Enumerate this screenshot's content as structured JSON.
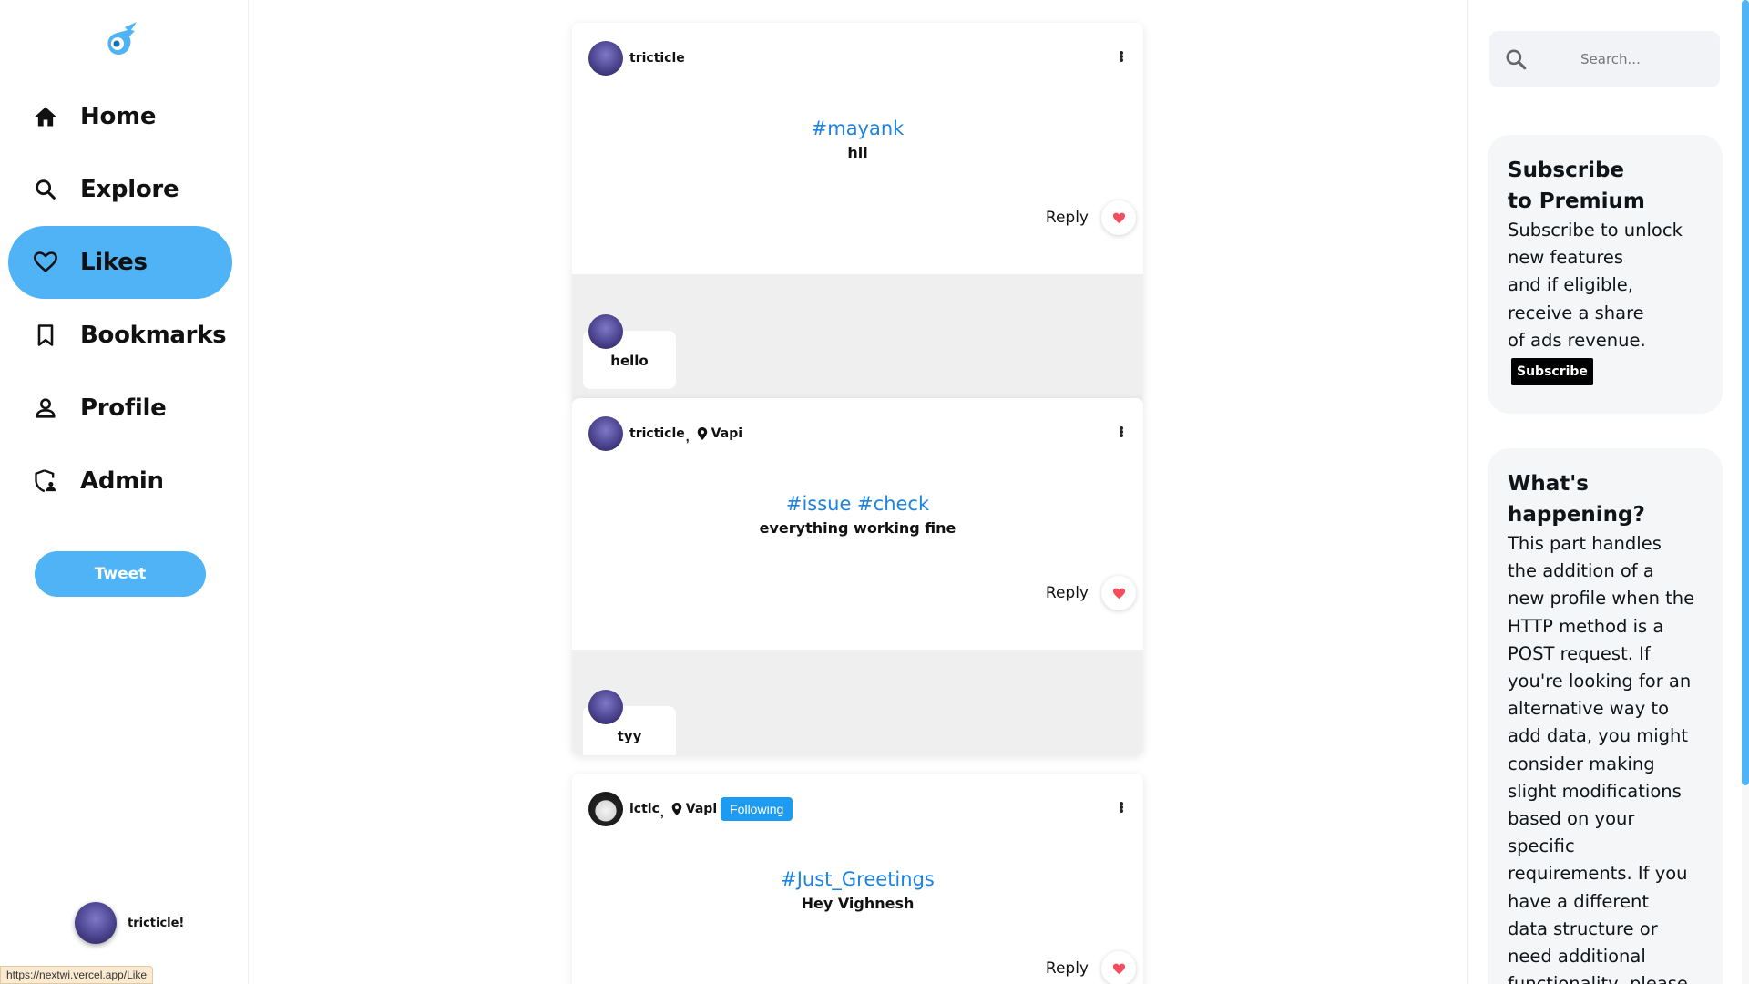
{
  "colors": {
    "accent": "#4fb3f6",
    "hashtag": "#1d82e0",
    "like": "#f44d5e",
    "following_badge": "#1d9bf0"
  },
  "sidebar": {
    "logo": "rocket-logo-icon",
    "items": [
      {
        "label": "Home",
        "icon": "home-icon"
      },
      {
        "label": "Explore",
        "icon": "search-icon"
      },
      {
        "label": "Likes",
        "icon": "heart-icon",
        "active": true
      },
      {
        "label": "Bookmarks",
        "icon": "bookmark-icon"
      },
      {
        "label": "Profile",
        "icon": "person-icon"
      },
      {
        "label": "Admin",
        "icon": "admin-shield-icon"
      }
    ],
    "tweet_button": "Tweet",
    "current_user": "tricticle!"
  },
  "status_bar_url": "https://nextwi.vercel.app/Like",
  "feed": {
    "posts": [
      {
        "author": "tricticle",
        "location": "",
        "following": "",
        "hashtag": "#mayank",
        "text": "hii",
        "reply_label": "Reply",
        "comments": [
          {
            "text": "hello"
          }
        ]
      },
      {
        "author": "tricticle",
        "location": "Vapi",
        "following": "",
        "hashtag": "#issue #check",
        "text": "everything working fine",
        "reply_label": "Reply",
        "comments": [
          {
            "text": "tyy"
          }
        ]
      },
      {
        "author": "ictic",
        "location": "Vapi",
        "following": "Following",
        "hashtag": "#Just_Greetings",
        "text": "Hey Vighnesh",
        "reply_label": "Reply",
        "comments": []
      }
    ]
  },
  "right": {
    "search_placeholder": "Search...",
    "premium": {
      "title_line1": "Subscribe",
      "title_line2": "to Premium",
      "body_lines": [
        "Subscribe to unlock",
        "new features",
        "and if eligible,",
        "receive a share",
        "of ads revenue."
      ],
      "button": "Subscribe"
    },
    "happening": {
      "title_line1": "What's",
      "title_line2": "happening?",
      "body_lines": [
        "This part handles",
        "the addition of a",
        "new profile when the",
        "HTTP method is a",
        "POST request. If",
        "you're looking for an",
        "alternative way to",
        "add data, you might",
        "consider making",
        "slight modifications",
        "based on your",
        "specific",
        "requirements. If you",
        "have a different",
        "data structure or",
        "need additional",
        "functionality, please"
      ]
    }
  }
}
